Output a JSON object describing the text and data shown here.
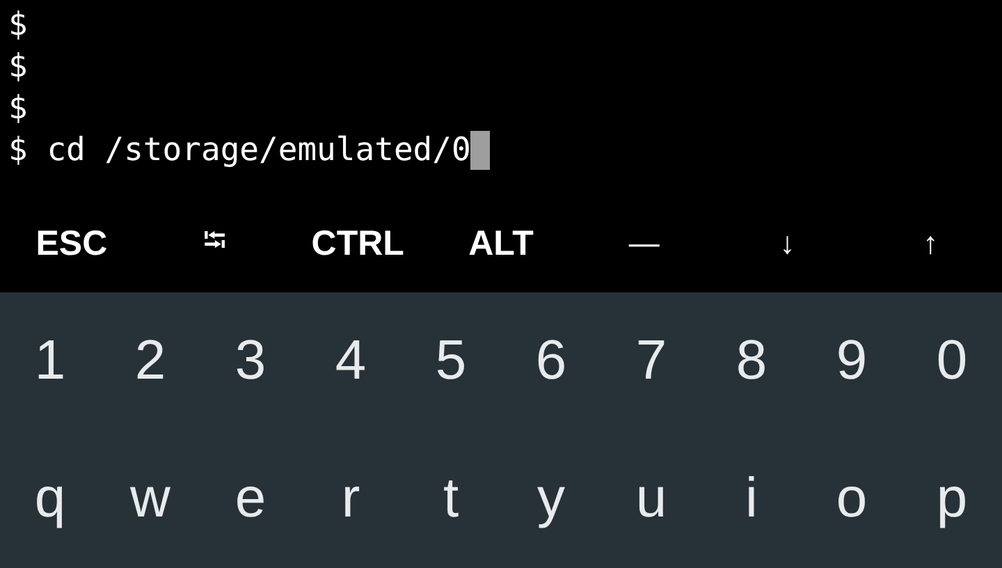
{
  "terminal": {
    "lines": [
      "$",
      "$",
      "$",
      "$ cd /storage/emulated/0"
    ]
  },
  "extra_keys": [
    "ESC",
    "⭾",
    "CTRL",
    "ALT",
    "—",
    "↓",
    "↑"
  ],
  "keyboard": {
    "rows": [
      [
        "1",
        "2",
        "3",
        "4",
        "5",
        "6",
        "7",
        "8",
        "9",
        "0"
      ],
      [
        "q",
        "w",
        "e",
        "r",
        "t",
        "y",
        "u",
        "i",
        "o",
        "p"
      ]
    ]
  }
}
